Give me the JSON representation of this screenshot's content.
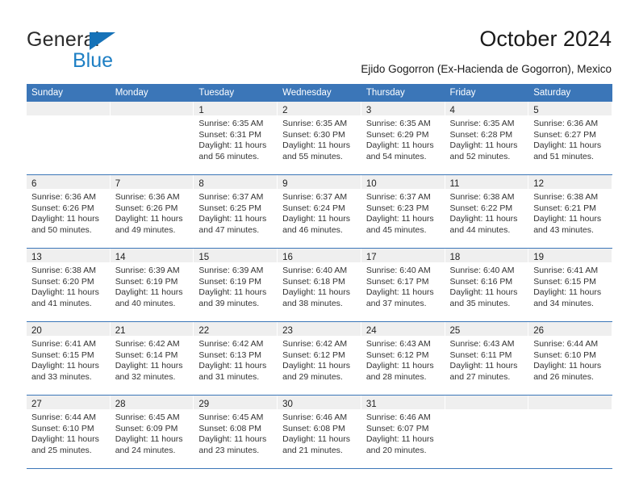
{
  "brand": {
    "name_top": "General",
    "name_bottom": "Blue",
    "accent_color": "#1672b8",
    "accent_color_light": "#1e7fc4"
  },
  "header": {
    "title": "October 2024",
    "subtitle": "Ejido Gogorron (Ex-Hacienda de Gogorron), Mexico"
  },
  "theme": {
    "header_blue": "#3b76b8",
    "daynum_band": "#efefef",
    "text": "#333333"
  },
  "calendar": {
    "weekday_headers": [
      "Sunday",
      "Monday",
      "Tuesday",
      "Wednesday",
      "Thursday",
      "Friday",
      "Saturday"
    ],
    "weeks": [
      [
        {
          "day": "",
          "lines": []
        },
        {
          "day": "",
          "lines": []
        },
        {
          "day": "1",
          "lines": [
            "Sunrise: 6:35 AM",
            "Sunset: 6:31 PM",
            "Daylight: 11 hours",
            "and 56 minutes."
          ]
        },
        {
          "day": "2",
          "lines": [
            "Sunrise: 6:35 AM",
            "Sunset: 6:30 PM",
            "Daylight: 11 hours",
            "and 55 minutes."
          ]
        },
        {
          "day": "3",
          "lines": [
            "Sunrise: 6:35 AM",
            "Sunset: 6:29 PM",
            "Daylight: 11 hours",
            "and 54 minutes."
          ]
        },
        {
          "day": "4",
          "lines": [
            "Sunrise: 6:35 AM",
            "Sunset: 6:28 PM",
            "Daylight: 11 hours",
            "and 52 minutes."
          ]
        },
        {
          "day": "5",
          "lines": [
            "Sunrise: 6:36 AM",
            "Sunset: 6:27 PM",
            "Daylight: 11 hours",
            "and 51 minutes."
          ]
        }
      ],
      [
        {
          "day": "6",
          "lines": [
            "Sunrise: 6:36 AM",
            "Sunset: 6:26 PM",
            "Daylight: 11 hours",
            "and 50 minutes."
          ]
        },
        {
          "day": "7",
          "lines": [
            "Sunrise: 6:36 AM",
            "Sunset: 6:26 PM",
            "Daylight: 11 hours",
            "and 49 minutes."
          ]
        },
        {
          "day": "8",
          "lines": [
            "Sunrise: 6:37 AM",
            "Sunset: 6:25 PM",
            "Daylight: 11 hours",
            "and 47 minutes."
          ]
        },
        {
          "day": "9",
          "lines": [
            "Sunrise: 6:37 AM",
            "Sunset: 6:24 PM",
            "Daylight: 11 hours",
            "and 46 minutes."
          ]
        },
        {
          "day": "10",
          "lines": [
            "Sunrise: 6:37 AM",
            "Sunset: 6:23 PM",
            "Daylight: 11 hours",
            "and 45 minutes."
          ]
        },
        {
          "day": "11",
          "lines": [
            "Sunrise: 6:38 AM",
            "Sunset: 6:22 PM",
            "Daylight: 11 hours",
            "and 44 minutes."
          ]
        },
        {
          "day": "12",
          "lines": [
            "Sunrise: 6:38 AM",
            "Sunset: 6:21 PM",
            "Daylight: 11 hours",
            "and 43 minutes."
          ]
        }
      ],
      [
        {
          "day": "13",
          "lines": [
            "Sunrise: 6:38 AM",
            "Sunset: 6:20 PM",
            "Daylight: 11 hours",
            "and 41 minutes."
          ]
        },
        {
          "day": "14",
          "lines": [
            "Sunrise: 6:39 AM",
            "Sunset: 6:19 PM",
            "Daylight: 11 hours",
            "and 40 minutes."
          ]
        },
        {
          "day": "15",
          "lines": [
            "Sunrise: 6:39 AM",
            "Sunset: 6:19 PM",
            "Daylight: 11 hours",
            "and 39 minutes."
          ]
        },
        {
          "day": "16",
          "lines": [
            "Sunrise: 6:40 AM",
            "Sunset: 6:18 PM",
            "Daylight: 11 hours",
            "and 38 minutes."
          ]
        },
        {
          "day": "17",
          "lines": [
            "Sunrise: 6:40 AM",
            "Sunset: 6:17 PM",
            "Daylight: 11 hours",
            "and 37 minutes."
          ]
        },
        {
          "day": "18",
          "lines": [
            "Sunrise: 6:40 AM",
            "Sunset: 6:16 PM",
            "Daylight: 11 hours",
            "and 35 minutes."
          ]
        },
        {
          "day": "19",
          "lines": [
            "Sunrise: 6:41 AM",
            "Sunset: 6:15 PM",
            "Daylight: 11 hours",
            "and 34 minutes."
          ]
        }
      ],
      [
        {
          "day": "20",
          "lines": [
            "Sunrise: 6:41 AM",
            "Sunset: 6:15 PM",
            "Daylight: 11 hours",
            "and 33 minutes."
          ]
        },
        {
          "day": "21",
          "lines": [
            "Sunrise: 6:42 AM",
            "Sunset: 6:14 PM",
            "Daylight: 11 hours",
            "and 32 minutes."
          ]
        },
        {
          "day": "22",
          "lines": [
            "Sunrise: 6:42 AM",
            "Sunset: 6:13 PM",
            "Daylight: 11 hours",
            "and 31 minutes."
          ]
        },
        {
          "day": "23",
          "lines": [
            "Sunrise: 6:42 AM",
            "Sunset: 6:12 PM",
            "Daylight: 11 hours",
            "and 29 minutes."
          ]
        },
        {
          "day": "24",
          "lines": [
            "Sunrise: 6:43 AM",
            "Sunset: 6:12 PM",
            "Daylight: 11 hours",
            "and 28 minutes."
          ]
        },
        {
          "day": "25",
          "lines": [
            "Sunrise: 6:43 AM",
            "Sunset: 6:11 PM",
            "Daylight: 11 hours",
            "and 27 minutes."
          ]
        },
        {
          "day": "26",
          "lines": [
            "Sunrise: 6:44 AM",
            "Sunset: 6:10 PM",
            "Daylight: 11 hours",
            "and 26 minutes."
          ]
        }
      ],
      [
        {
          "day": "27",
          "lines": [
            "Sunrise: 6:44 AM",
            "Sunset: 6:10 PM",
            "Daylight: 11 hours",
            "and 25 minutes."
          ]
        },
        {
          "day": "28",
          "lines": [
            "Sunrise: 6:45 AM",
            "Sunset: 6:09 PM",
            "Daylight: 11 hours",
            "and 24 minutes."
          ]
        },
        {
          "day": "29",
          "lines": [
            "Sunrise: 6:45 AM",
            "Sunset: 6:08 PM",
            "Daylight: 11 hours",
            "and 23 minutes."
          ]
        },
        {
          "day": "30",
          "lines": [
            "Sunrise: 6:46 AM",
            "Sunset: 6:08 PM",
            "Daylight: 11 hours",
            "and 21 minutes."
          ]
        },
        {
          "day": "31",
          "lines": [
            "Sunrise: 6:46 AM",
            "Sunset: 6:07 PM",
            "Daylight: 11 hours",
            "and 20 minutes."
          ]
        },
        {
          "day": "",
          "lines": []
        },
        {
          "day": "",
          "lines": []
        }
      ]
    ]
  }
}
